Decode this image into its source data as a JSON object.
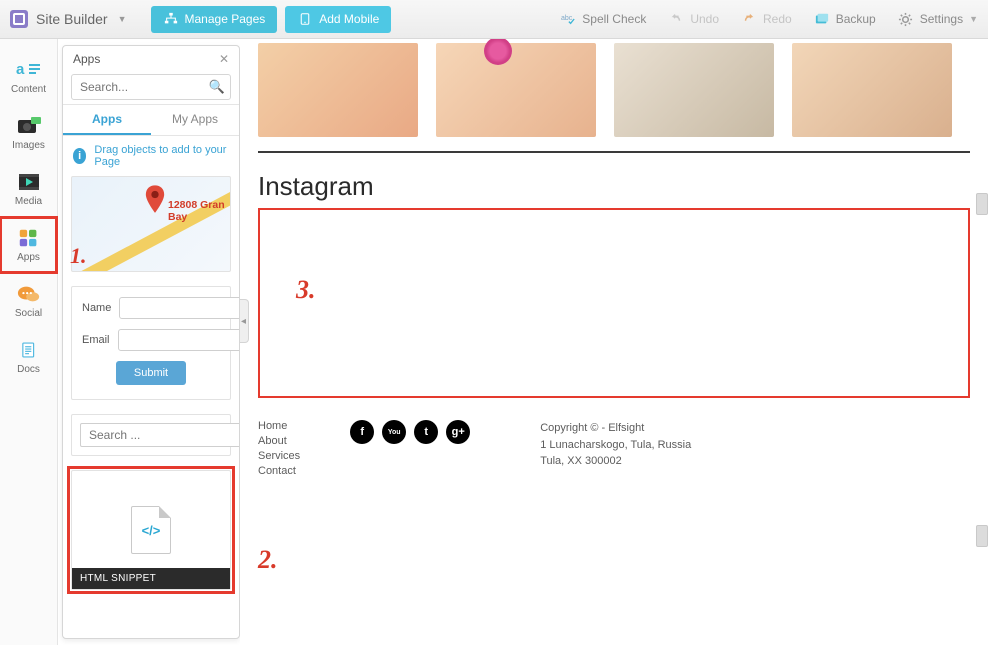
{
  "topbar": {
    "title": "Site Builder",
    "manage_pages": "Manage Pages",
    "add_mobile": "Add Mobile",
    "spell_check": "Spell Check",
    "undo": "Undo",
    "redo": "Redo",
    "backup": "Backup",
    "settings": "Settings"
  },
  "rail": {
    "content": "Content",
    "images": "Images",
    "media": "Media",
    "apps": "Apps",
    "social": "Social",
    "docs": "Docs"
  },
  "panel": {
    "title": "Apps",
    "search_placeholder": "Search...",
    "tab_apps": "Apps",
    "tab_myapps": "My Apps",
    "info_text": "Drag objects to add to your Page",
    "map_address": "12808 Gran Bay",
    "form": {
      "name": "Name",
      "email": "Email",
      "submit": "Submit"
    },
    "search_card_placeholder": "Search ...",
    "snippet_label": "HTML SNIPPET",
    "snippet_glyph": "</>"
  },
  "canvas": {
    "section_title": "Instagram",
    "footer_nav": {
      "home": "Home",
      "about": "About",
      "services": "Services",
      "contact": "Contact"
    },
    "social": {
      "fb": "f",
      "yt": "You",
      "tw": "t",
      "gp": "g+"
    },
    "copyright_line1": "Copyright © - Elfsight",
    "copyright_line2": "1 Lunacharskogo, Tula, Russia",
    "copyright_line3": "Tula, XX 300002"
  },
  "annotations": {
    "one": "1.",
    "two": "2.",
    "three": "3."
  }
}
